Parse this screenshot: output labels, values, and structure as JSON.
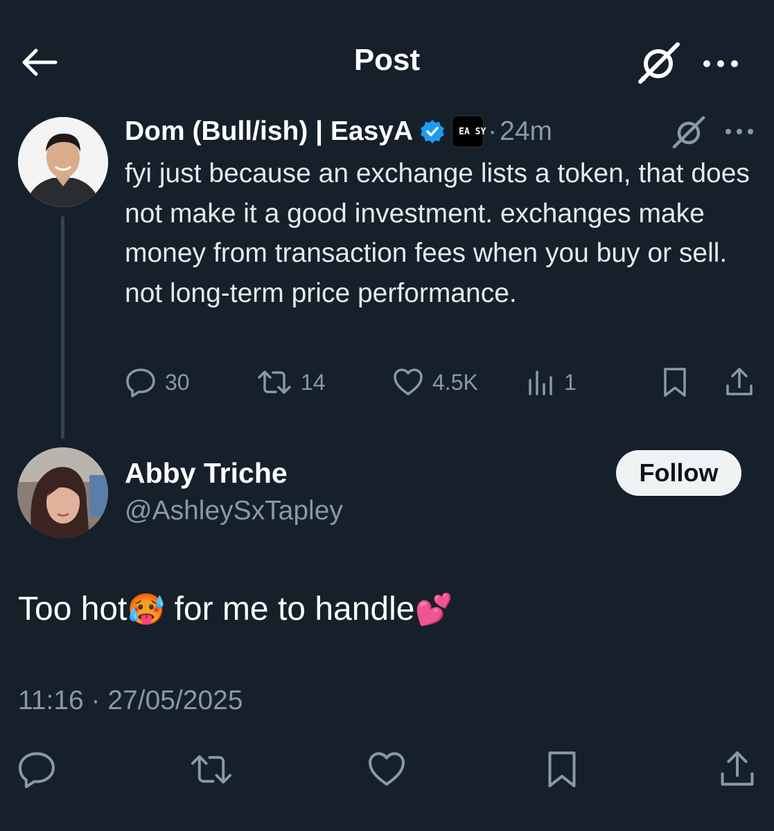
{
  "header": {
    "title": "Post",
    "back_icon": "arrow-left-icon",
    "grok_icon": "grok-icon",
    "more_icon": "more-dots-icon"
  },
  "parent_tweet": {
    "display_name": "Dom (Bull/ish) | EasyA",
    "verified": true,
    "affiliation_badge": "EA SY",
    "dot": "·",
    "time": "24m",
    "text": "fyi just because an exchange lists a token, that does not make it a good investment. exchanges make money from transaction fees when you buy or sell. not long-term price performance.",
    "actions": {
      "replies": "30",
      "reposts": "14",
      "likes": "4.5K",
      "views": "1"
    }
  },
  "reply": {
    "display_name": "Abby Triche",
    "handle": "@AshleySxTapley",
    "follow_label": "Follow",
    "text_part1": "Too hot",
    "emoji1": "🥵",
    "text_part2": " for me to handle",
    "emoji2": "💕",
    "timestamp": "11:16 · 27/05/2025"
  },
  "colors": {
    "background": "#15202b",
    "text_primary": "#e7e9ea",
    "text_secondary": "#8b98a5",
    "verified_blue": "#1d9bf0",
    "follow_bg": "#eff3f4"
  }
}
